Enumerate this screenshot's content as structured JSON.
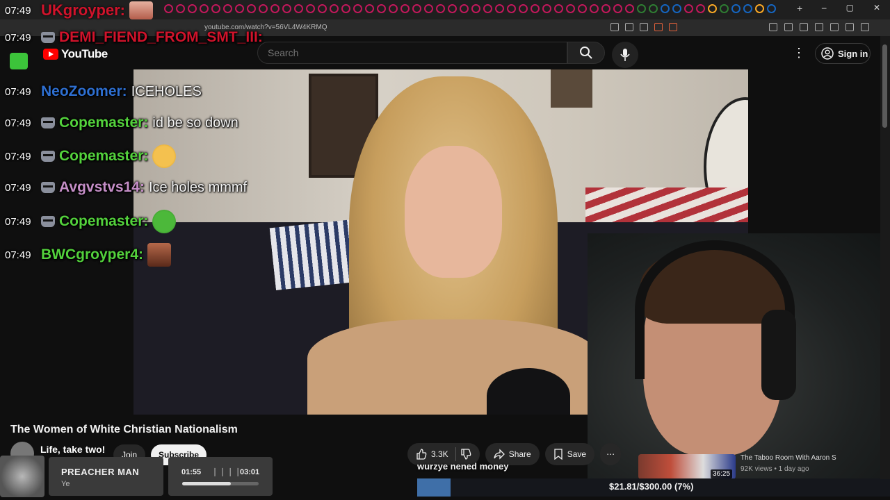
{
  "browser": {
    "url": "youtube.com/watch?v=56VL4W4KRMQ",
    "new_tab": "+"
  },
  "youtube": {
    "logo_text": "YouTube",
    "search_placeholder": "Search",
    "sign_in_label": "Sign in"
  },
  "video": {
    "title": "The Women of White Christian Nationalism",
    "channel_name": "Life, take two!",
    "join_label": "Join",
    "subscribe_label": "Subscribe",
    "likes": "3.3K",
    "share_label": "Share",
    "save_label": "Save"
  },
  "recommended": {
    "title": "The Taboo Room With Aaron S",
    "meta": "92K views • 1 day ago",
    "duration": "36:25"
  },
  "chat": {
    "top_name": "UKgroyper:",
    "top_time": "07:49",
    "lines": [
      {
        "time": "07:49",
        "name": "DEMI_FIEND_FROM_SMT_III:",
        "msg": "",
        "color": "#d0132b"
      },
      {
        "time": "07:49",
        "name": "NeoZoomer:",
        "msg": "ICEHOLES",
        "color": "#2e6fd1"
      },
      {
        "time": "07:49",
        "name": "Copemaster:",
        "msg": "id be so down",
        "color": "#53d13c"
      },
      {
        "time": "07:49",
        "name": "Copemaster:",
        "msg": "",
        "color": "#53d13c"
      },
      {
        "time": "07:49",
        "name": "Avgvstvs14:",
        "msg": "Ice holes mmmf",
        "color": "#c58ec7"
      },
      {
        "time": "07:49",
        "name": "Copemaster:",
        "msg": "",
        "color": "#53d13c"
      },
      {
        "time": "07:49",
        "name": "BWCgroyper4:",
        "msg": "",
        "color": "#53d13c"
      }
    ]
  },
  "stream": {
    "ticker": "wurzye nened money",
    "donation": "$21.81/$300.00 (7%)",
    "donation_progress": 0.07,
    "music_title": "PREACHER MAN",
    "music_artist": "Ye",
    "music_current": "01:55",
    "music_total": "03:01",
    "music_progress": 0.64
  },
  "colors": {
    "youtube_red": "#ff0000",
    "background": "#0f0f0f"
  }
}
